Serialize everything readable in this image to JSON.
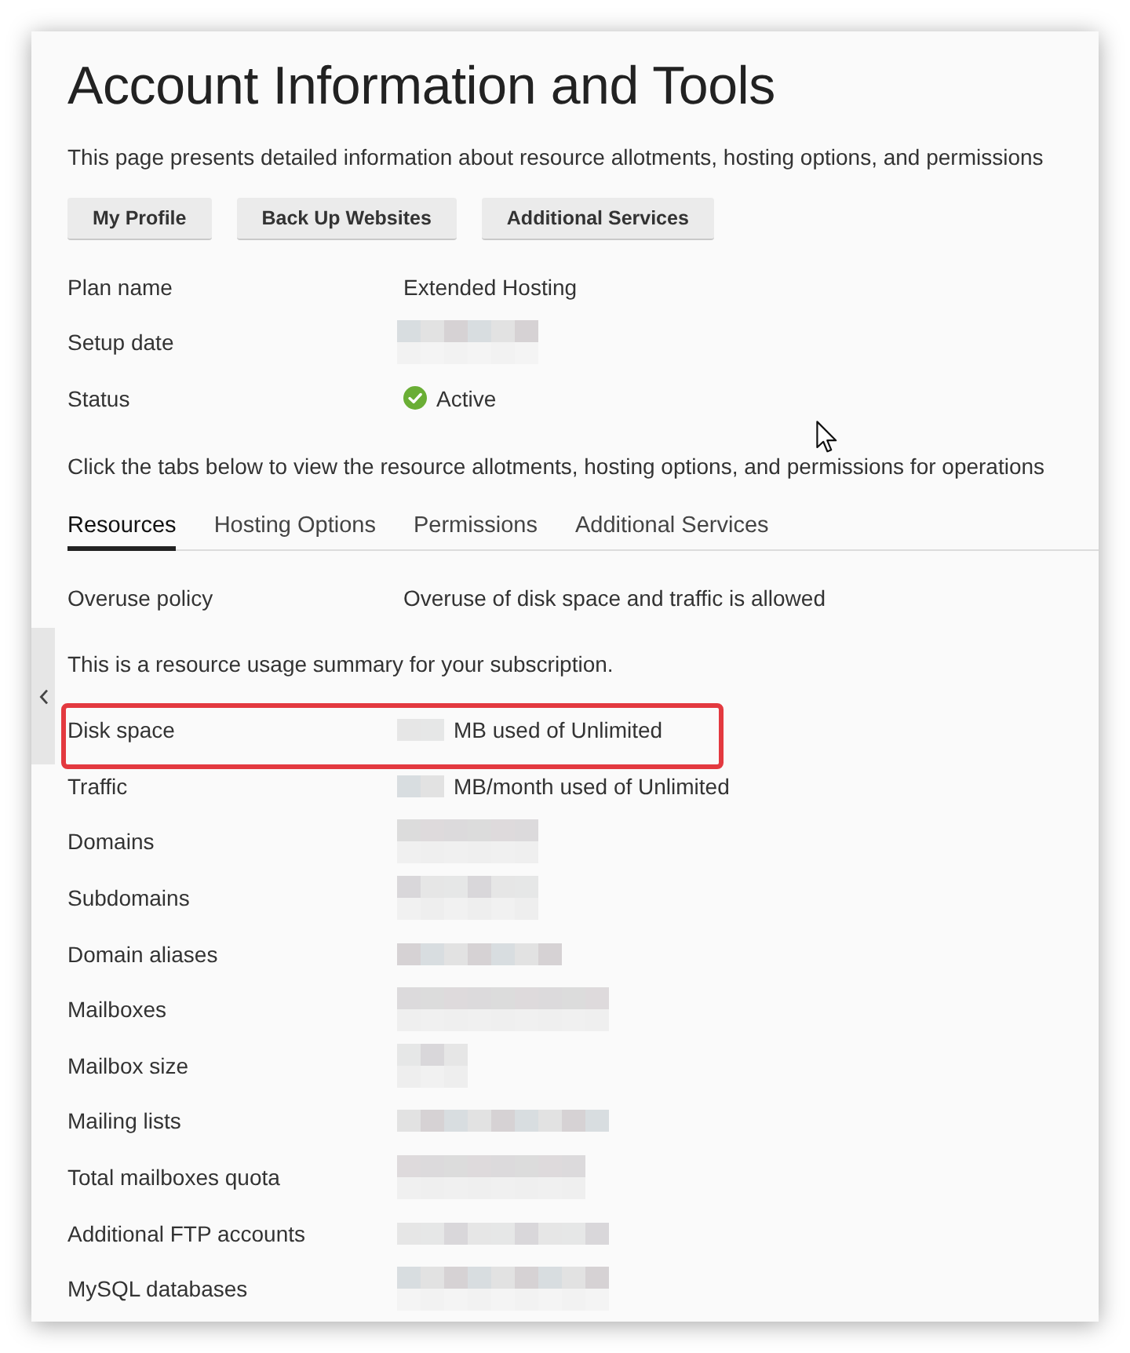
{
  "title": "Account Information and Tools",
  "description": "This page presents detailed information about resource allotments, hosting options, and permissions",
  "buttons": [
    {
      "label": "My Profile"
    },
    {
      "label": "Back Up Websites"
    },
    {
      "label": "Additional Services"
    }
  ],
  "subscription_rows": [
    {
      "label": "Plan name",
      "kind": "text",
      "value": "Extended Hosting",
      "redacted": false
    },
    {
      "label": "Setup date",
      "kind": "text",
      "redacted": true
    },
    {
      "label": "Status",
      "kind": "status",
      "value": "Active",
      "redacted": false
    }
  ],
  "tabs_hint": "Click the tabs below to view the resource allotments, hosting options, and permissions for operations",
  "tabs": [
    {
      "label": "Resources",
      "selected": true
    },
    {
      "label": "Hosting Options",
      "selected": false
    },
    {
      "label": "Permissions",
      "selected": false
    },
    {
      "label": "Additional Services",
      "selected": false
    }
  ],
  "policy_rows": [
    {
      "label": "Overuse policy",
      "value": "Overuse of disk space and traffic is allowed",
      "redacted": false
    }
  ],
  "usage_intro": "This is a resource usage summary for your subscription.",
  "usage_rows": [
    {
      "label": "Disk space",
      "value": "MB used of Unlimited",
      "redacted": true,
      "highlighted": true
    },
    {
      "label": "Traffic",
      "value": "MB/month used of Unlimited",
      "redacted": true,
      "highlighted": false
    },
    {
      "label": "Domains",
      "redacted": true,
      "highlighted": false
    },
    {
      "label": "Subdomains",
      "redacted": true,
      "highlighted": false
    },
    {
      "label": "Domain aliases",
      "redacted": true,
      "highlighted": false
    },
    {
      "label": "Mailboxes",
      "redacted": true,
      "highlighted": false
    },
    {
      "label": "Mailbox size",
      "redacted": true,
      "highlighted": false
    },
    {
      "label": "Mailing lists",
      "redacted": true,
      "highlighted": false
    },
    {
      "label": "Total mailboxes quota",
      "redacted": true,
      "highlighted": false
    },
    {
      "label": "Additional FTP accounts",
      "redacted": true,
      "highlighted": false
    },
    {
      "label": "MySQL databases",
      "redacted": true,
      "highlighted": false
    }
  ]
}
